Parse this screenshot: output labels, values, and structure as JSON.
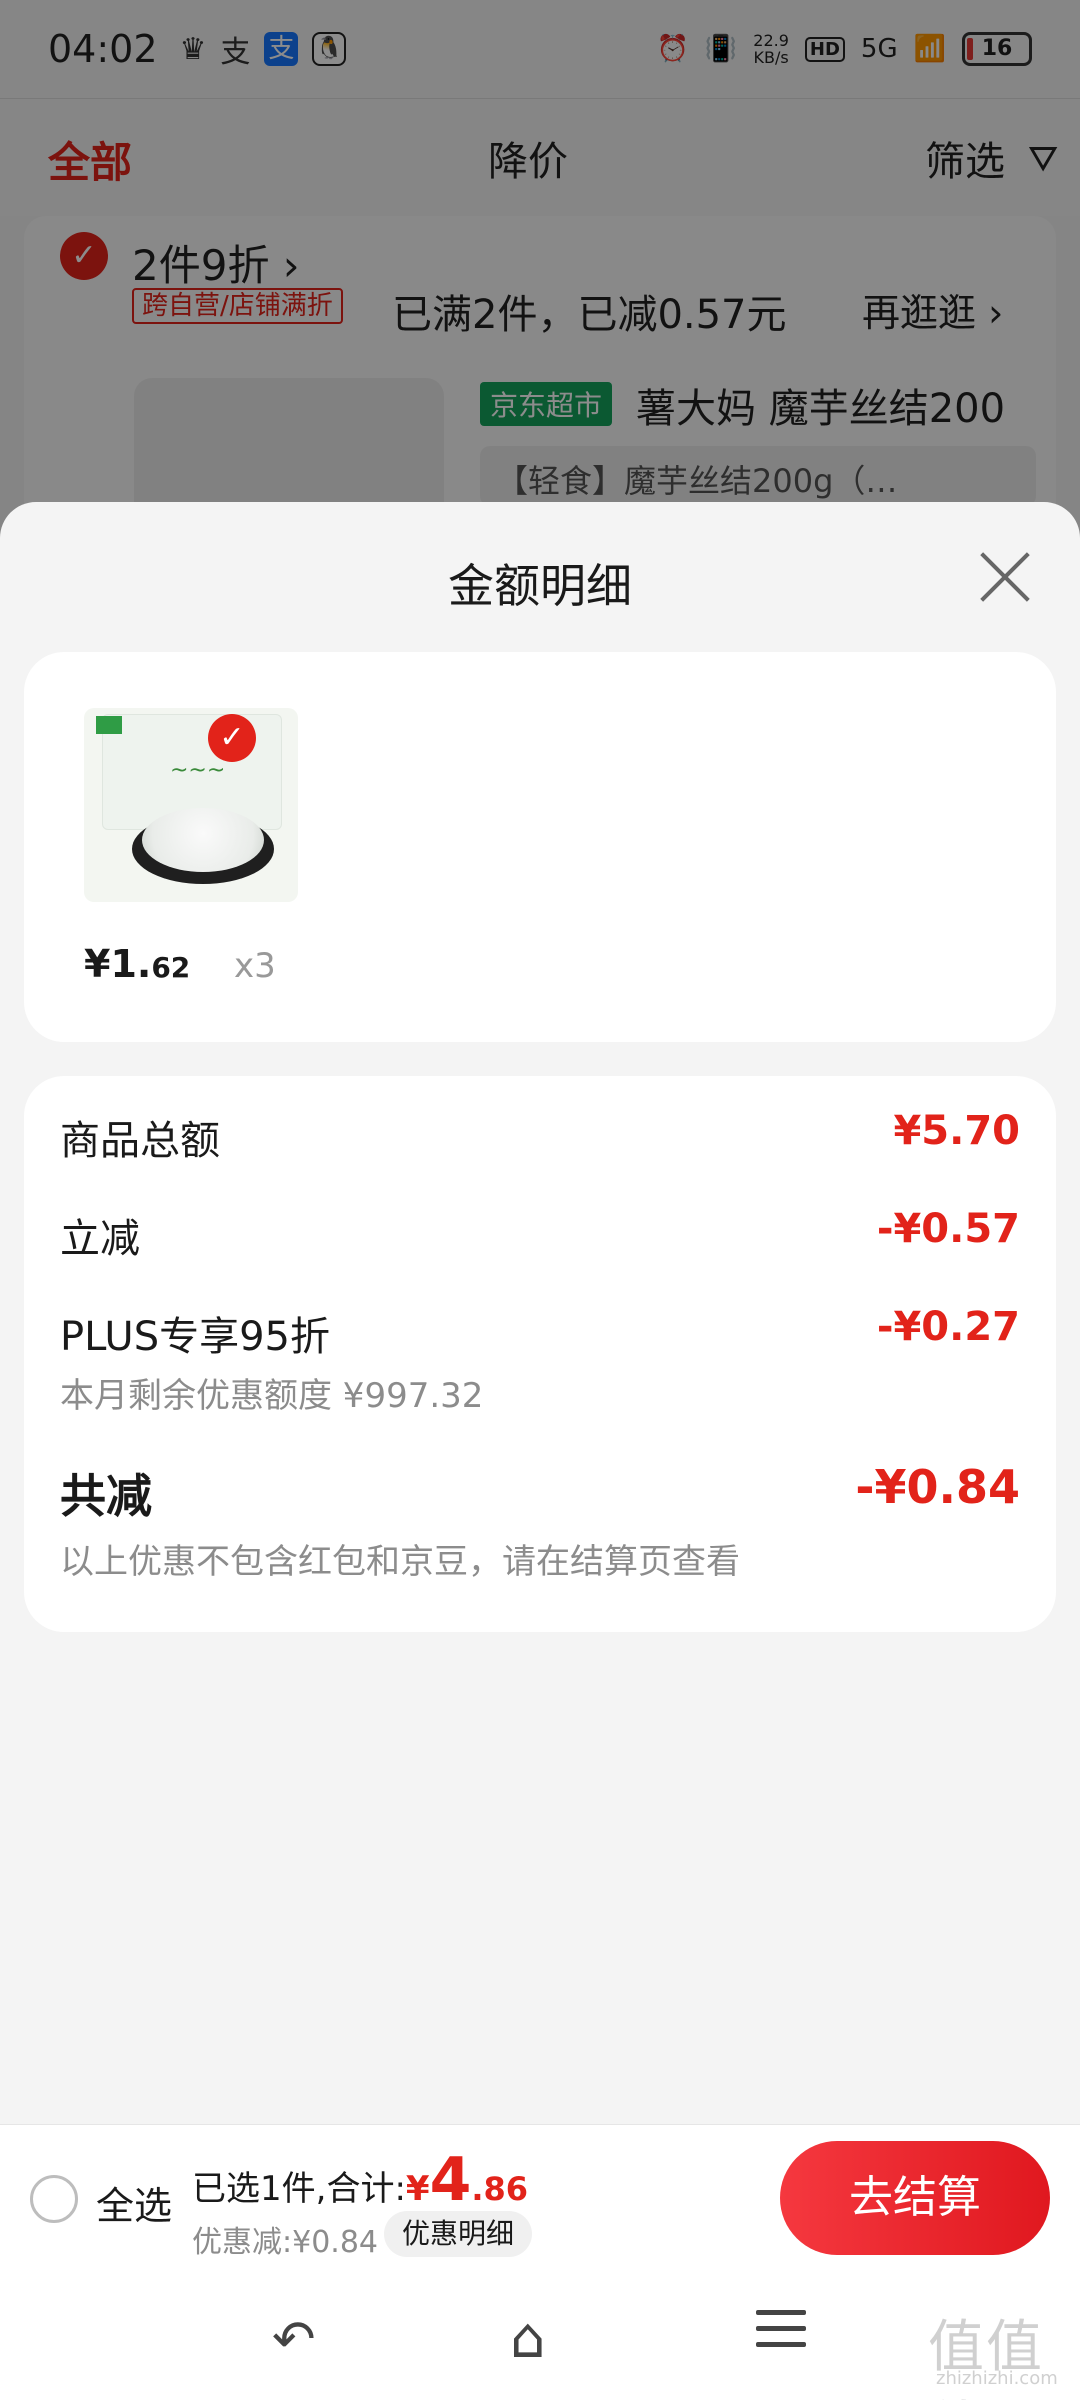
{
  "status_bar": {
    "time": "04:02",
    "net_speed_value": "22.9",
    "net_speed_unit": "KB/s",
    "hd": "HD",
    "signal": "5G",
    "battery": "16"
  },
  "filter_bar": {
    "tab_all": "全部",
    "tab_price_drop": "降价",
    "filter_label": "筛选"
  },
  "shop": {
    "promo": "2件9折 ›",
    "promo_tag": "跨自营/店铺满折",
    "promo_met": "已满2件，已减0.57元",
    "promo_more": "再逛逛 ›",
    "store_tag": "京东超市",
    "product_title": "薯大妈 魔芋丝结200",
    "product_spec": "【轻食】魔芋丝结200g（…"
  },
  "sheet": {
    "title": "金额明细",
    "item": {
      "price_int": "¥1.",
      "price_dec": "62",
      "quantity": "x3"
    },
    "rows": {
      "total_label": "商品总额",
      "total_value": "¥5.70",
      "instant_label": "立减",
      "instant_value": "-¥0.57",
      "plus_label": "PLUS专享95折",
      "plus_value": "-¥0.27",
      "plus_sub": "本月剩余优惠额度 ¥997.32",
      "saved_label": "共减",
      "saved_value": "-¥0.84",
      "saved_sub": "以上优惠不包含红包和京豆，请在结算页查看"
    }
  },
  "checkout": {
    "select_all": "全选",
    "selected_text": "已选1件,合计:",
    "currency": "¥",
    "total_int": "4",
    "total_dec": ".86",
    "discount_text": "优惠减:¥0.84",
    "discount_detail": "优惠明细",
    "button": "去结算"
  },
  "watermark": {
    "main": "值值值",
    "sub": "zhizhizhi.com"
  },
  "colors": {
    "accent": "#e2231a",
    "store_tag": "#14a35b"
  }
}
